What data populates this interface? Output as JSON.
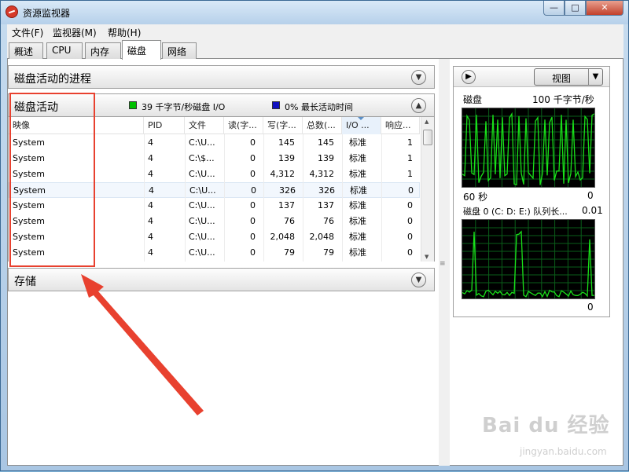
{
  "window": {
    "title": "资源监视器"
  },
  "menu": [
    "文件(F)",
    "监视器(M)",
    "帮助(H)"
  ],
  "tabs": [
    "概述",
    "CPU",
    "内存",
    "磁盘",
    "网络"
  ],
  "sections": {
    "processes": "磁盘活动的进程",
    "disk_activity": "磁盘活动",
    "storage": "存储"
  },
  "legend": {
    "io": "39 千字节/秒磁盘 I/O",
    "io_color": "#00c000",
    "active": "0% 最长活动时间",
    "active_color": "#1010c0"
  },
  "table": {
    "columns": [
      "映像",
      "PID",
      "文件",
      "读(字...",
      "写(字...",
      "总数(...",
      "I/O ...",
      "响应..."
    ],
    "rows": [
      [
        "System",
        "4",
        "C:\\U...",
        "0",
        "145",
        "145",
        "标准",
        "1"
      ],
      [
        "System",
        "4",
        "C:\\$...",
        "0",
        "139",
        "139",
        "标准",
        "1"
      ],
      [
        "System",
        "4",
        "C:\\U...",
        "0",
        "4,312",
        "4,312",
        "标准",
        "1"
      ],
      [
        "System",
        "4",
        "C:\\U...",
        "0",
        "326",
        "326",
        "标准",
        "0"
      ],
      [
        "System",
        "4",
        "C:\\U...",
        "0",
        "137",
        "137",
        "标准",
        "0"
      ],
      [
        "System",
        "4",
        "C:\\U...",
        "0",
        "76",
        "76",
        "标准",
        "0"
      ],
      [
        "System",
        "4",
        "C:\\U...",
        "0",
        "2,048",
        "2,048",
        "标准",
        "0"
      ],
      [
        "System",
        "4",
        "C:\\U...",
        "0",
        "79",
        "79",
        "标准",
        "0"
      ]
    ]
  },
  "right_pane": {
    "view_button": "视图",
    "graph1": {
      "label": "磁盘",
      "scale": "100 千字节/秒",
      "time": "60 秒",
      "min": "0"
    },
    "graph2": {
      "label": "磁盘 0 (C: D: E:) 队列长...",
      "scale": "0.01",
      "min": "0"
    }
  },
  "watermark": {
    "brand": "Bai du 经验",
    "url": "jingyan.baidu.com"
  }
}
